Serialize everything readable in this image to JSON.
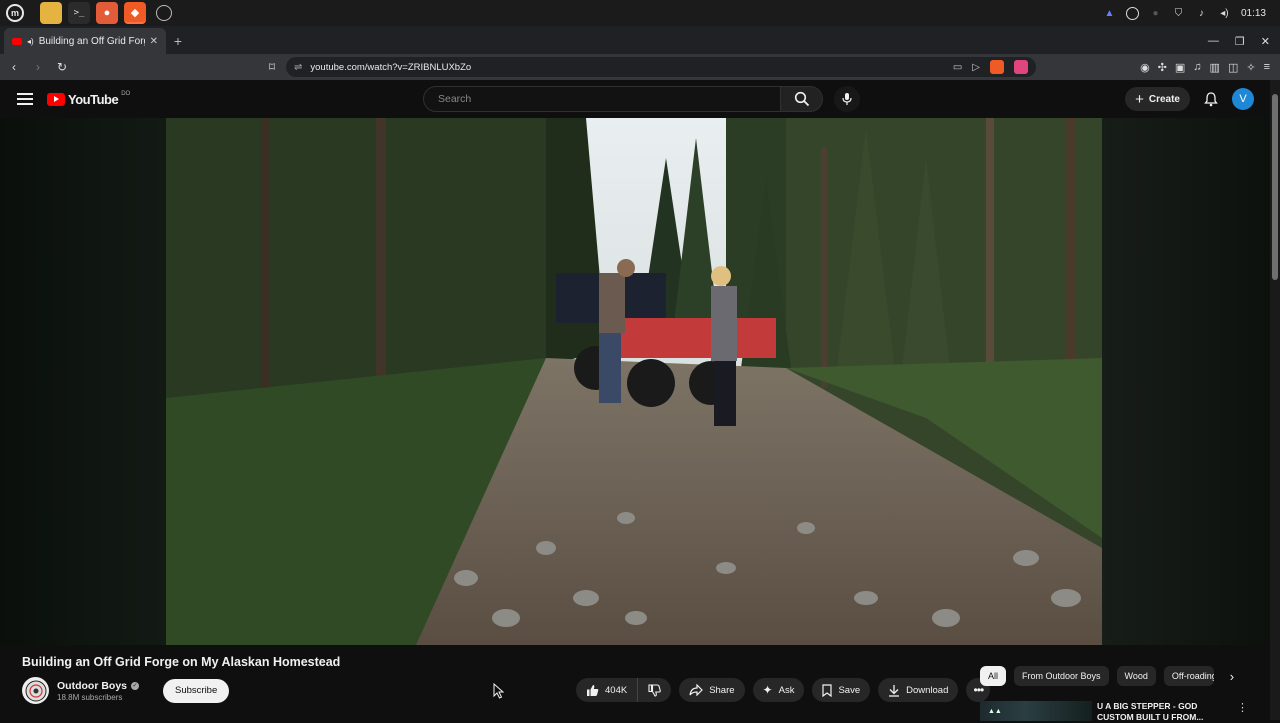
{
  "os": {
    "clock": "01:13",
    "apps": [
      "files-icon",
      "terminal-icon",
      "firefox-icon",
      "brave-icon",
      "chrome-icon"
    ]
  },
  "browser": {
    "tab_title": "Building an Off Grid Forge",
    "new_tab": "+",
    "url": "youtube.com/watch?v=ZRIBNLUXbZo",
    "close": "✕"
  },
  "youtube": {
    "logo_text": "YouTube",
    "logo_country": "DO",
    "search_placeholder": "Search",
    "create_label": "Create",
    "avatar_letter": "V"
  },
  "video": {
    "title": "Building an Off Grid Forge on My Alaskan Homestead",
    "channel_name": "Outdoor Boys",
    "subscribers": "18.8M subscribers",
    "subscribe_label": "Subscribe",
    "likes": "404K",
    "share_label": "Share",
    "ask_label": "Ask",
    "save_label": "Save",
    "download_label": "Download"
  },
  "chips": [
    "All",
    "From Outdoor Boys",
    "Wood",
    "Off-roading"
  ],
  "recommendation": {
    "badge": "U A BIG STEPPER",
    "title": "U A BIG STEPPER - GOD CUSTOM BUILT U FROM..."
  },
  "colors": {
    "accent": "#ff0000",
    "avatar": "#1e88d6",
    "background": "#0f0f0f"
  }
}
